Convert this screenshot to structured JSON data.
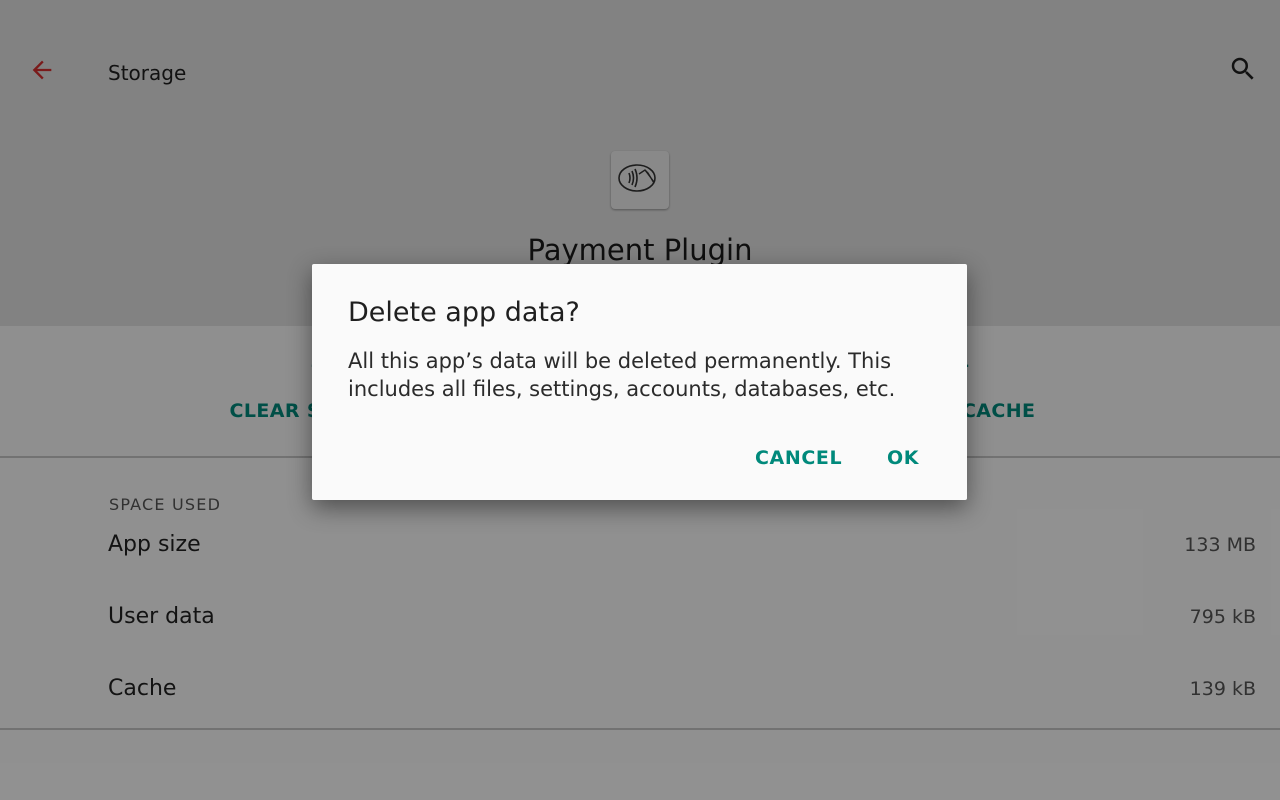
{
  "toolbar": {
    "title": "Storage",
    "back_icon": "arrow-back-icon",
    "search_icon": "search-icon"
  },
  "app": {
    "name": "Payment Plugin",
    "icon": "contactless-payment-icon"
  },
  "actions": {
    "clear_storage_label": "CLEAR STORAGE",
    "clear_cache_label": "CLEAR CACHE",
    "clear_storage_icon": "delete-icon",
    "clear_cache_icon": "delete-icon"
  },
  "space_used": {
    "header": "SPACE USED",
    "rows": [
      {
        "label": "App size",
        "value": "133 MB"
      },
      {
        "label": "User data",
        "value": "795 kB"
      },
      {
        "label": "Cache",
        "value": "139 kB"
      }
    ]
  },
  "dialog": {
    "title": "Delete app data?",
    "message": "All this app’s data will be deleted permanently. This includes all files, settings, accounts, databases, etc.",
    "cancel_label": "CANCEL",
    "ok_label": "OK"
  },
  "colors": {
    "accent": "#00897b",
    "back_arrow": "#d32f2f",
    "header_bg": "#e0e0e0"
  }
}
